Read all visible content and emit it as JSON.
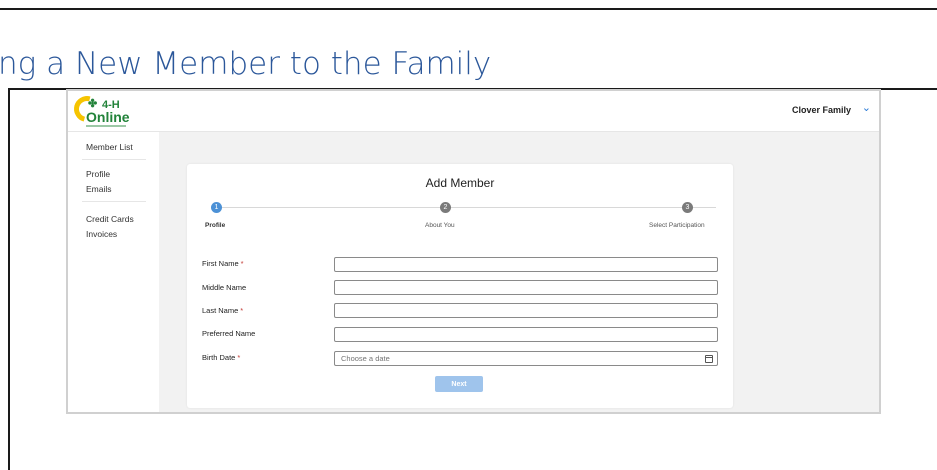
{
  "doc": {
    "heading": "ng a New Member to the Family"
  },
  "app": {
    "logo_top": "4-H",
    "logo_bottom": "Online",
    "family_name": "Clover Family"
  },
  "sidebar": {
    "items": [
      {
        "label": "Member List"
      },
      {
        "label": "Profile"
      },
      {
        "label": "Emails"
      },
      {
        "label": "Credit Cards"
      },
      {
        "label": "Invoices"
      }
    ]
  },
  "form": {
    "title": "Add Member",
    "steps": [
      {
        "number": "1",
        "label": "Profile"
      },
      {
        "number": "2",
        "label": "About You"
      },
      {
        "number": "3",
        "label": "Select Participation"
      }
    ],
    "fields": [
      {
        "label": "First Name",
        "required": "*",
        "value": ""
      },
      {
        "label": "Middle Name",
        "required": "",
        "value": ""
      },
      {
        "label": "Last Name",
        "required": "*",
        "value": ""
      },
      {
        "label": "Preferred Name",
        "required": "",
        "value": ""
      },
      {
        "label": "Birth Date",
        "required": "*",
        "placeholder": "Choose a date"
      }
    ],
    "next_label": "Next"
  },
  "colors": {
    "heading": "#2b579a",
    "brand_green": "#22833a",
    "accent_blue": "#4c91d6",
    "required_red": "#c23934"
  }
}
